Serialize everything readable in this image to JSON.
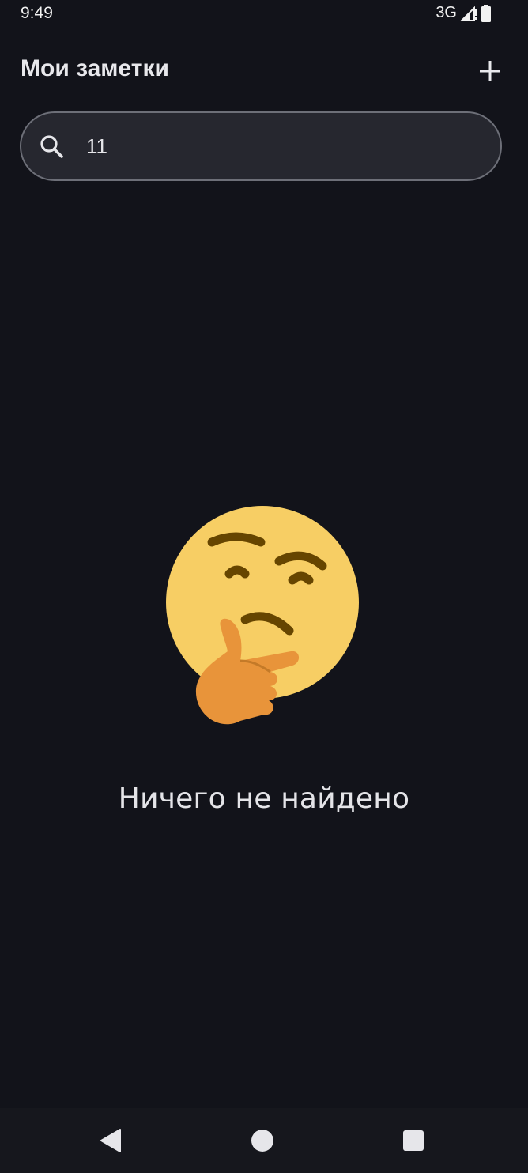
{
  "status_bar": {
    "time": "9:49",
    "network": "3G",
    "icons": [
      "signal-icon",
      "battery-icon"
    ]
  },
  "header": {
    "title": "Мои заметки",
    "add_icon": "plus-icon"
  },
  "search": {
    "value": "11",
    "icon": "search-icon"
  },
  "empty_state": {
    "icon": "thinking-face-emoji",
    "message": "Ничего не найдено"
  },
  "nav_bar": {
    "icons": [
      "back-icon",
      "home-icon",
      "recents-icon"
    ]
  },
  "colors": {
    "background": "#12131a",
    "search_bg": "#26272f",
    "search_border": "#6d6f78",
    "text": "#e6e6ea",
    "emoji_face": "#f7ce64",
    "emoji_hand": "#e8943a",
    "emoji_features": "#664500"
  }
}
